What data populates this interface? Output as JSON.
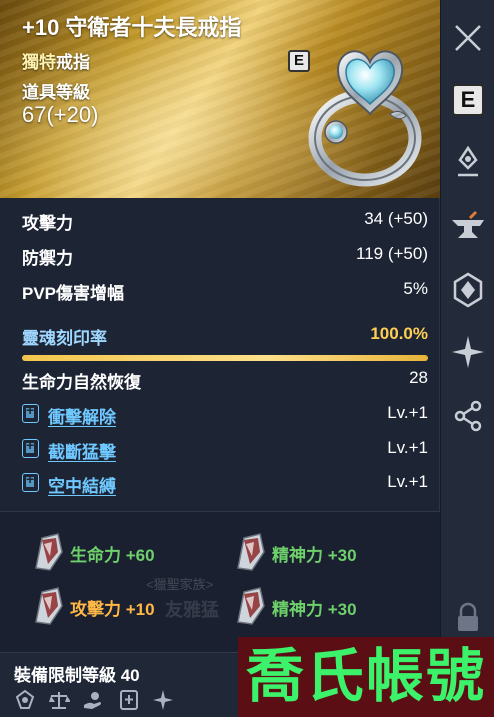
{
  "item": {
    "title": "+10 守衛者十夫長戒指",
    "rarity": "獨特",
    "type": "戒指",
    "item_level_label": "道具等級",
    "item_level_value": "67(+20)",
    "grade_badge": "E"
  },
  "stats": [
    {
      "label": "攻擊力",
      "value": "34 (+50)"
    },
    {
      "label": "防禦力",
      "value": "119 (+50)"
    },
    {
      "label": "PVP傷害增幅",
      "value": "5%"
    }
  ],
  "soul": {
    "label": "靈魂刻印率",
    "value": "100.0%",
    "fill": 1.0
  },
  "regen": {
    "label": "生命力自然恢復",
    "value": "28"
  },
  "skills": [
    {
      "label": "衝擊解除",
      "value": "Lv.+1"
    },
    {
      "label": "截斷猛擊",
      "value": "Lv.+1"
    },
    {
      "label": "空中結縛",
      "value": "Lv.+1"
    }
  ],
  "bonuses": [
    {
      "label": "生命力 +60",
      "color": "#6ed06a"
    },
    {
      "label": "精神力 +30",
      "color": "#6ed06a"
    },
    {
      "label": "攻擊力 +10",
      "color": "#ffb845"
    },
    {
      "label": "精神力 +30",
      "color": "#6ed06a"
    }
  ],
  "faint_overlay": [
    "<獵聖家族>",
    "友雅猛"
  ],
  "footer": {
    "equip_level": "裝備限制等級 40",
    "icons": [
      "soul-bind-icon",
      "scale-icon",
      "hand-coin-icon",
      "skillbook-icon",
      "sparkle-icon"
    ]
  },
  "rail": {
    "buttons": [
      "close-icon",
      "e-grade-icon",
      "pin-marker-icon",
      "anvil-icon",
      "crest-icon",
      "star-burst-icon",
      "share-icon",
      "lock-icon"
    ],
    "e_label": "E"
  },
  "watermark": "喬氏帳號"
}
